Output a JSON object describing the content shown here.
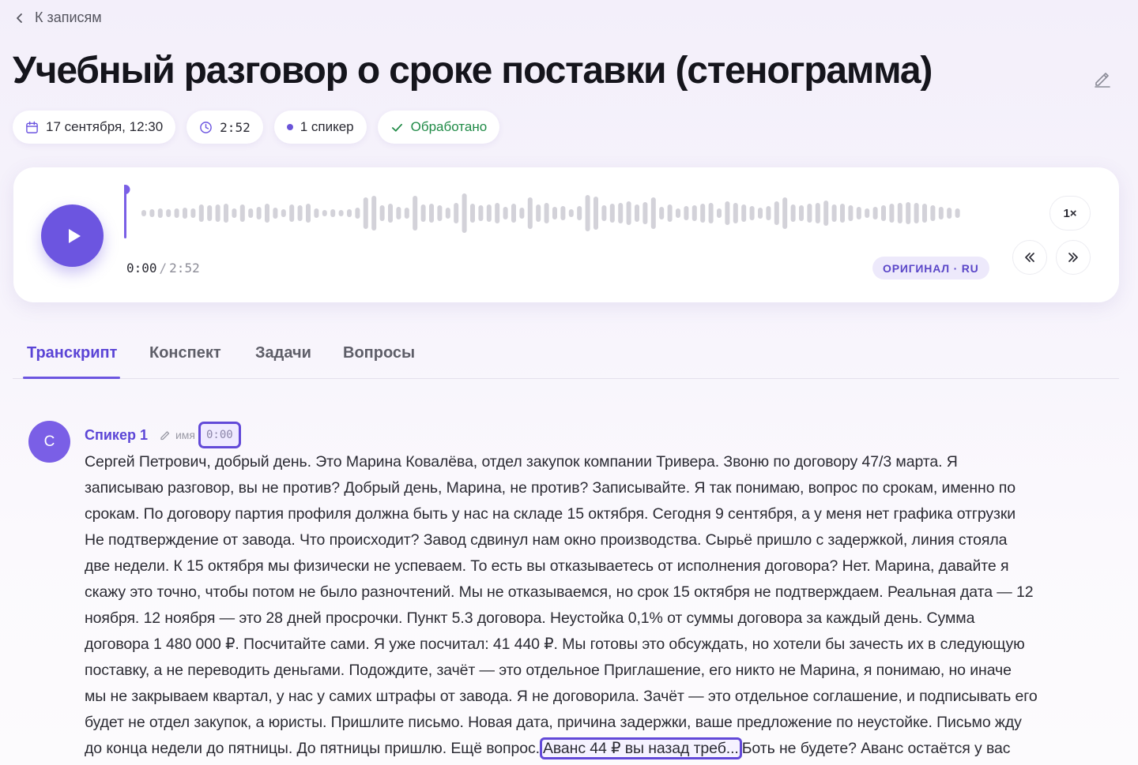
{
  "nav": {
    "back_label": "К записям"
  },
  "title": "Учебный разговор о сроке поставки (стенограмма)",
  "chips": {
    "date": "17 сентября, 12:30",
    "duration": "2:52",
    "speakers": "1 спикер",
    "status": "Обработано"
  },
  "player": {
    "current_time": "0:00",
    "separator": "/",
    "total_time": "2:52",
    "language_badge": "ОРИГИНАЛ · RU",
    "speed": "1×",
    "progress": 0
  },
  "tabs": [
    {
      "label": "Транскрипт",
      "active": true
    },
    {
      "label": "Конспект",
      "active": false
    },
    {
      "label": "Задачи",
      "active": false
    },
    {
      "label": "Вопросы",
      "active": false
    }
  ],
  "segment": {
    "avatar_letter": "С",
    "speaker": "Спикер 1",
    "rename_label": "имя",
    "timestamp": "0:00",
    "lines": [
      "Сергей Петрович, добрый день. Это Марина Ковалёва, отдел закупок компании Тривера. Звоню по договору 47/3 марта. Я",
      "записываю разговор, вы не против? Добрый день, Марина, не против? Записывайте. Я так понимаю, вопрос по срокам, именно по",
      "срокам. По договору партия профиля должна быть у нас на складе 15 октября. Сегодня 9 сентября, а у меня нет графика отгрузки",
      "Не подтверждение от завода. Что происходит? Завод сдвинул нам окно производства. Сырьё пришло с задержкой, линия стояла",
      "две недели. К 15 октября мы физически не успеваем. То есть вы отказываетесь от исполнения договора? Нет. Марина, давайте я",
      "скажу это точно, чтобы потом не было разночтений. Мы не отказываемся, но срок 15 октября не подтверждаем. Реальная дата — 12",
      "ноября. 12 ноября — это 28 дней просрочки. Пункт 5.3 договора. Неустойка 0,1% от суммы договора за каждый день. Сумма",
      "договора 1 480 000 ₽. Посчитайте сами. Я уже посчитал: 41 440 ₽. Мы готовы это обсуждать, но хотели бы зачесть их в следующую",
      "поставку, а не переводить деньгами. Подождите, зачёт — это отдельное Приглашение, его никто не Марина, я понимаю, но иначе",
      "мы не закрываем квартал, у нас у самих штрафы от завода. Я не договорила. Зачёт — это отдельное соглашение, и подписывать его",
      "будет не отдел закупок, а юристы. Пришлите письмо. Новая дата, причина задержки, ваше предложение по неустойке. Письмо жду"
    ],
    "last_line_before": "до конца недели до пятницы. До пятницы пришлю. Ещё вопрос.",
    "last_line_highlight": "Аванс 44 ₽ вы назад треб...",
    "last_line_after": "Боть не будете? Аванс остаётся у вас"
  },
  "colors": {
    "accent": "#6c55e0",
    "status_green": "#1f8a46"
  },
  "icons": {
    "back": "chevron-left-icon",
    "edit": "pencil-icon",
    "calendar": "calendar-icon",
    "clock": "clock-icon",
    "check": "check-icon",
    "play": "play-icon",
    "rewind": "rewind-icon",
    "forward": "forward-icon"
  }
}
